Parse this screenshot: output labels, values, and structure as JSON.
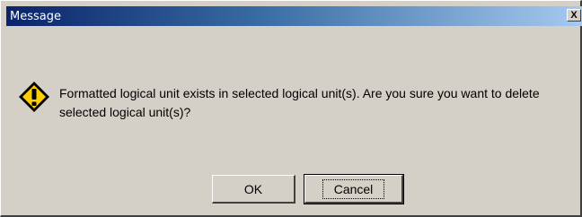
{
  "window": {
    "title": "Message",
    "close_glyph": "X"
  },
  "icon": {
    "name": "warning-icon",
    "color": "#ffcc00"
  },
  "message": {
    "text": "Formatted logical unit exists in selected logical unit(s). Are you sure you want to delete selected logical unit(s)?"
  },
  "buttons": {
    "ok_label": "OK",
    "cancel_label": "Cancel"
  }
}
